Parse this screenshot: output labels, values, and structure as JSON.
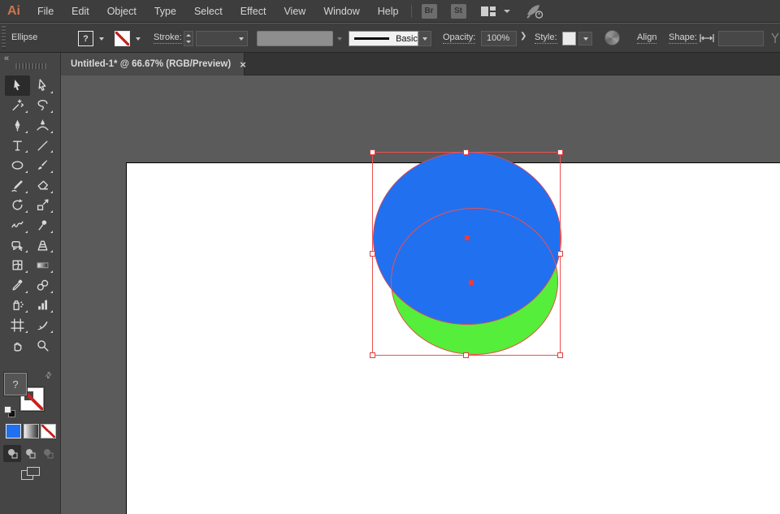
{
  "app": {
    "logo_text": "Ai"
  },
  "menubar": {
    "items": [
      "File",
      "Edit",
      "Object",
      "Type",
      "Select",
      "Effect",
      "View",
      "Window",
      "Help"
    ],
    "bridge_button": "Br",
    "stock_button": "St"
  },
  "controlbar": {
    "selected_tool_label": "Ellipse",
    "fill_indicator": "?",
    "stroke_label": "Stroke:",
    "stroke_style_value": "Basic",
    "opacity_label": "Opacity:",
    "opacity_value": "100%",
    "forward_chevron": "❯",
    "style_label": "Style:",
    "align_button": "Align",
    "shape_label": "Shape:",
    "shape_field_value": ""
  },
  "document_tab": {
    "title": "Untitled-1* @ 66.67% (RGB/Preview)",
    "close_glyph": "×"
  },
  "toolbar": {
    "active_tool": "selection",
    "fill_indicator": "?",
    "tools": [
      "selection",
      "direct-selection",
      "magic-wand",
      "lasso",
      "pen",
      "curvature",
      "type",
      "line-segment",
      "ellipse",
      "paintbrush",
      "shaper-pencil",
      "eraser",
      "rotate",
      "scale",
      "width",
      "puppet-warp",
      "free-transform",
      "perspective-grid",
      "mesh",
      "gradient",
      "eyedropper",
      "blend",
      "symbol-sprayer",
      "column-graph",
      "artboard",
      "slice",
      "hand",
      "zoom"
    ],
    "drawing_modes": [
      "draw-normal",
      "draw-behind",
      "draw-inside"
    ]
  },
  "icons": {
    "collapse_glyph": "«",
    "swap_glyph": "⇄"
  },
  "artwork": {
    "zoom_percent": "66.67%",
    "color_mode": "RGB/Preview",
    "shapes": [
      {
        "name": "blue-circle",
        "type": "ellipse",
        "fill": "#2170f0"
      },
      {
        "name": "green-circle",
        "type": "ellipse",
        "fill": "#55ee3b"
      }
    ],
    "selection_color": "#ee5050"
  },
  "colors": {
    "blue_fill": "#2170f0",
    "green_fill": "#55ee3b",
    "selection_red": "#ee5050",
    "logo_orange": "#c9764f",
    "pasteboard_gray": "#5b5b5b",
    "chrome_gray": "#3d3d3d"
  }
}
